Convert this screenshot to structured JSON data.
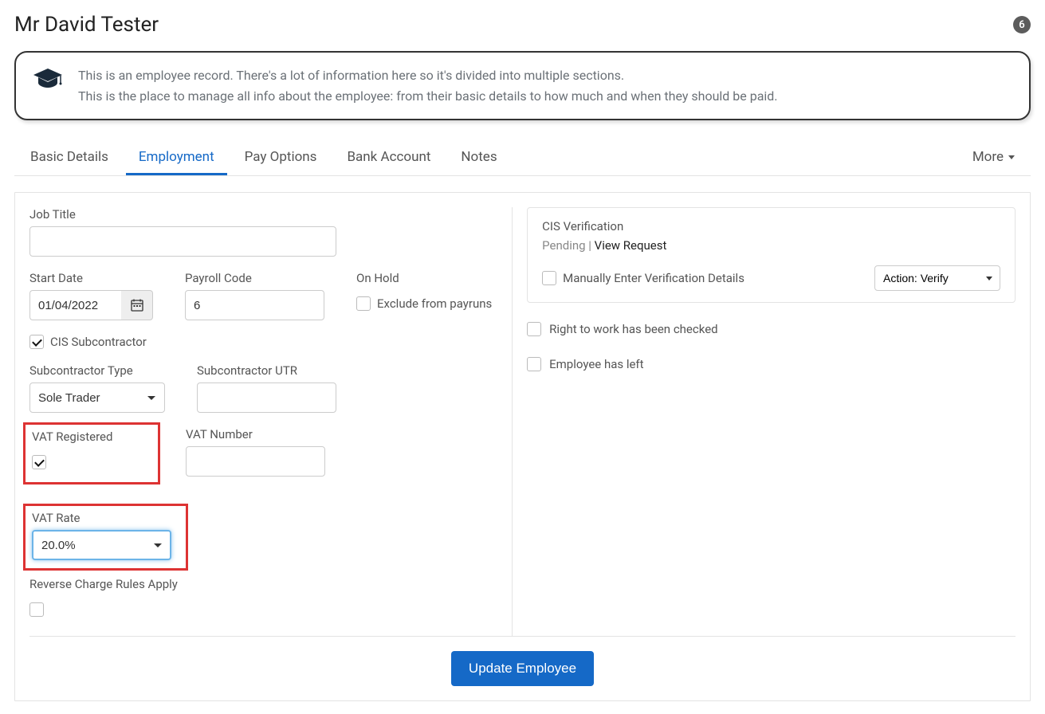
{
  "header": {
    "title": "Mr David Tester",
    "badge_count": "6"
  },
  "info": {
    "line1": "This is an employee record. There's a lot of information here so it's divided into multiple sections.",
    "line2": "This is the place to manage all info about the employee: from their basic details to how much and when they should be paid."
  },
  "tabs": {
    "basic": "Basic Details",
    "employment": "Employment",
    "pay": "Pay Options",
    "bank": "Bank Account",
    "notes": "Notes",
    "more": "More"
  },
  "form": {
    "job_title_label": "Job Title",
    "job_title_value": "",
    "start_date_label": "Start Date",
    "start_date_value": "01/04/2022",
    "payroll_code_label": "Payroll Code",
    "payroll_code_value": "6",
    "on_hold_label": "On Hold",
    "exclude_payruns_label": "Exclude from payruns",
    "cis_sub_label": "CIS Subcontractor",
    "sub_type_label": "Subcontractor Type",
    "sub_type_value": "Sole Trader",
    "sub_utr_label": "Subcontractor UTR",
    "sub_utr_value": "",
    "vat_reg_label": "VAT Registered",
    "vat_number_label": "VAT Number",
    "vat_number_value": "",
    "vat_rate_label": "VAT Rate",
    "vat_rate_value": "20.0%",
    "reverse_charge_label": "Reverse Charge Rules Apply"
  },
  "cis": {
    "title": "CIS Verification",
    "status": "Pending",
    "separator": " | ",
    "view_request": "View Request",
    "manual_label": "Manually Enter Verification Details",
    "action_value": "Action: Verify"
  },
  "right_block": {
    "rtw_label": "Right to work has been checked",
    "left_label": "Employee has left"
  },
  "footer": {
    "submit_label": "Update Employee"
  }
}
